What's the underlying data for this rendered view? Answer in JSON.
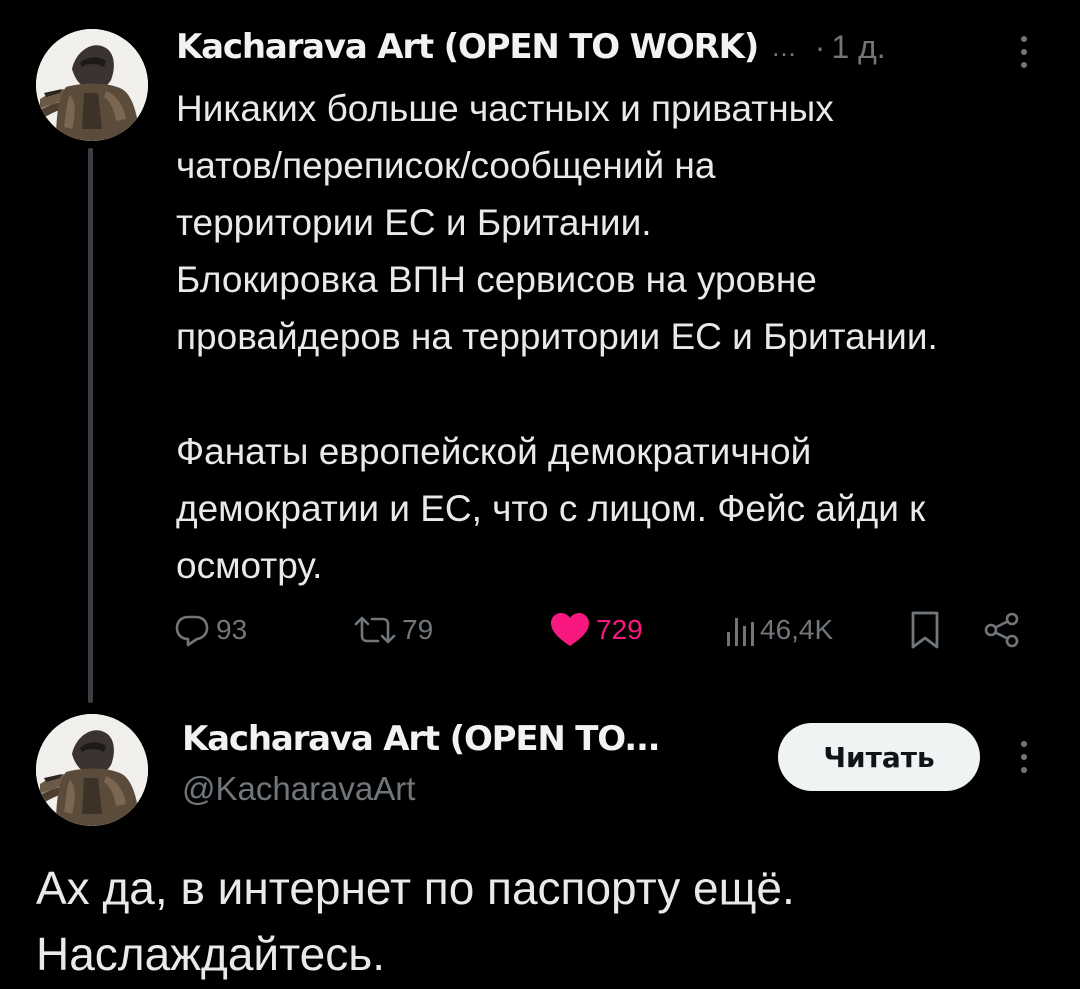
{
  "thread": {
    "post1": {
      "author_name": "Kacharava Art (OPEN TO WORK)",
      "truncation": "...",
      "separator": "·",
      "timestamp": "1 д.",
      "text_lines": [
        "Никаких больше частных и приватных",
        "чатов/переписок/сообщений на",
        "территории ЕС и Британии.",
        "Блокировка ВПН сервисов на уровне",
        "провайдеров на территории ЕС и Британии.",
        "",
        "Фанаты европейской демократичной",
        "демократии и ЕС, что с лицом. Фейс айди к",
        "осмотру."
      ],
      "actions": {
        "replies": "93",
        "reposts": "79",
        "likes": "729",
        "views": "46,4K"
      },
      "liked": true
    },
    "post2": {
      "author_name": "Kacharava Art (OPEN TO...",
      "handle": "@KacharavaArt",
      "follow_label": "Читать",
      "text_lines": [
        "Ах да, в интернет по паспорту ещё.",
        "Наслаждайтесь."
      ]
    }
  },
  "colors": {
    "background": "#000000",
    "text": "#e7e9ea",
    "muted": "#71767b",
    "like": "#f91880",
    "button_bg": "#eff3f4",
    "thread_line": "#3a3d41"
  },
  "icons": [
    "avatar-image",
    "more-icon",
    "reply-icon",
    "repost-icon",
    "like-icon",
    "views-icon",
    "bookmark-icon",
    "share-icon"
  ]
}
